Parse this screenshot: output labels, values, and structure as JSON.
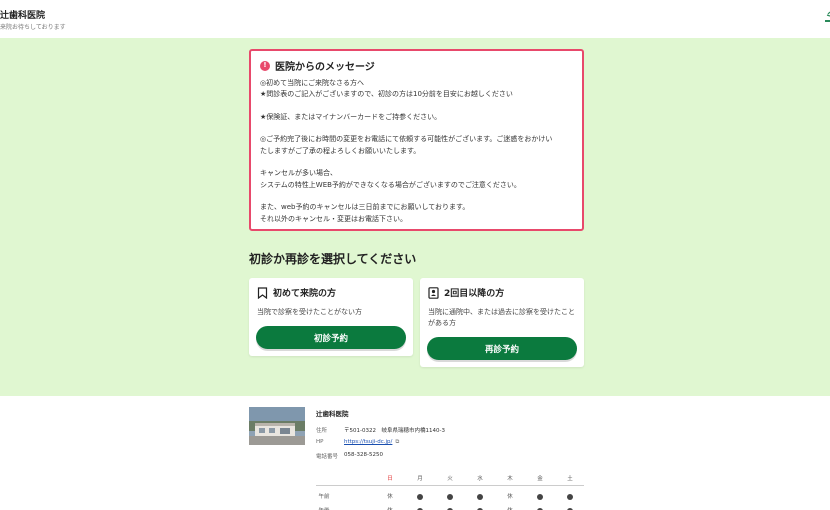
{
  "header": {
    "title": "辻歯科医院",
    "subtitle": "来院お待ちしております"
  },
  "message": {
    "title": "医院からのメッセージ",
    "lines": [
      "◎初めて当院にご来院なさる方へ",
      "★問診表のご記入がございますので、初診の方は10分前を目安にお越しください",
      "",
      "★保険証、またはマイナンバーカードをご持参ください。",
      "",
      "◎ご予約完了後にお時間の変更をお電話にて依頼する可能性がございます。ご迷惑をおかけい",
      "たしますがご了承の程よろしくお願いいたします。",
      "",
      "キャンセルが多い場合、",
      "システムの特性上WEB予約ができなくなる場合がございますのでご注意ください。",
      "",
      "また、web予約のキャンセルは三日前までにお願いしております。",
      "それ以外のキャンセル・変更はお電話下さい。"
    ]
  },
  "select_heading": "初診か再診を選択してください",
  "cards": {
    "first": {
      "title": "初めて来院の方",
      "desc": "当院で診察を受けたことがない方",
      "button": "初診予約"
    },
    "return": {
      "title": "2回目以降の方",
      "desc": "当院に通院中、または過去に診察を受けたことがある方",
      "button": "再診予約"
    }
  },
  "footer": {
    "name": "辻歯科医院",
    "address_label": "住所",
    "address": "〒501-0322　岐阜県瑞穂市内橋1140-3",
    "hp_label": "HP",
    "hp": "https://tsuji-dc.jp/",
    "phone_label": "電話番号",
    "phone": "058-328-5250",
    "days": [
      "日",
      "月",
      "火",
      "水",
      "木",
      "金",
      "土"
    ],
    "rows": [
      {
        "label": "午前",
        "cells": [
          "休",
          "●",
          "●",
          "●",
          "休",
          "●",
          "●"
        ]
      },
      {
        "label": "午後",
        "cells": [
          "休",
          "●",
          "●",
          "●",
          "休",
          "●",
          "●"
        ]
      }
    ]
  },
  "colors": {
    "accent": "#0b7a3e",
    "alert": "#e8496b",
    "background": "#e0f7d1"
  }
}
